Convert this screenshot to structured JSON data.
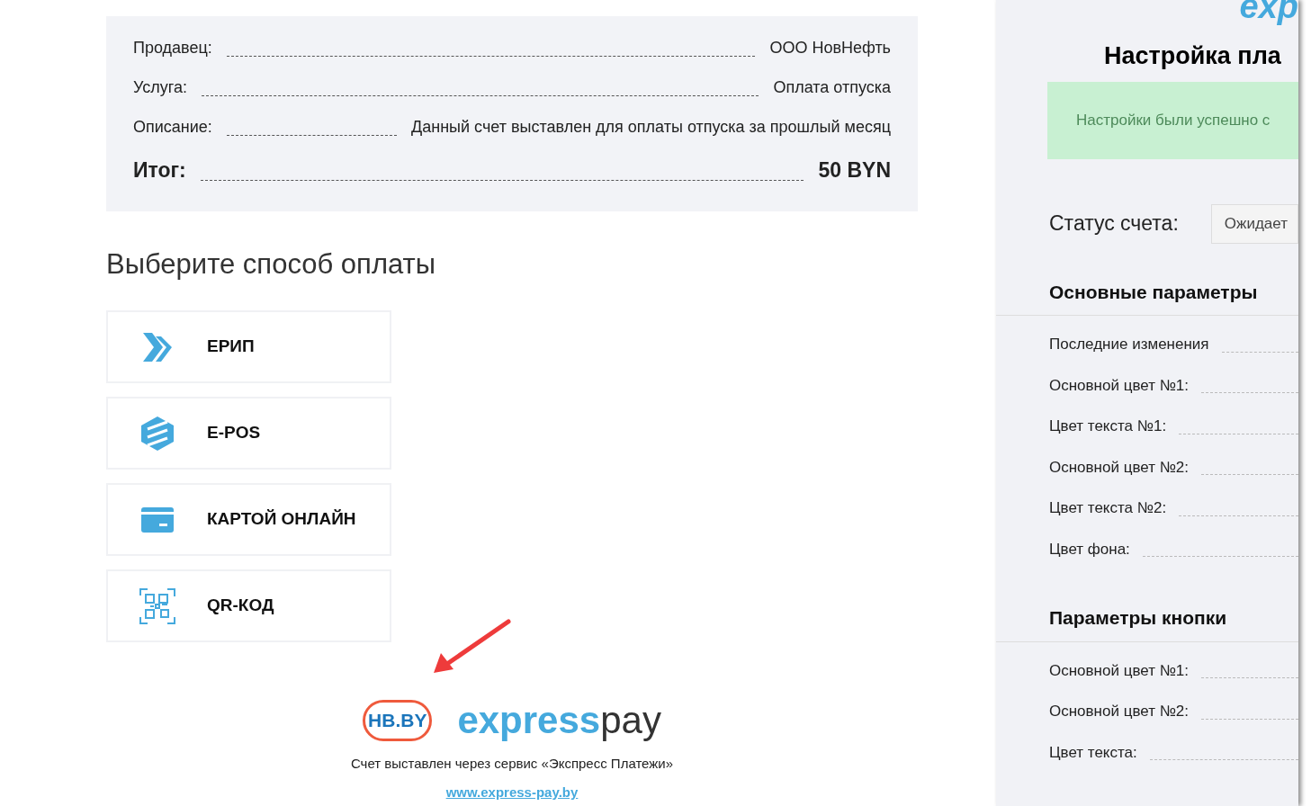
{
  "invoice": {
    "rows": [
      {
        "label": "Продавец:",
        "value": "ООО НовНефть"
      },
      {
        "label": "Услуга:",
        "value": "Оплата отпуска"
      },
      {
        "label": "Описание:",
        "value": "Данный счет выставлен для оплаты отпуска за прошлый месяц"
      }
    ],
    "total": {
      "label": "Итог:",
      "value": "50 BYN"
    }
  },
  "payment": {
    "heading": "Выберите способ оплаты",
    "methods": [
      {
        "kind": "erip",
        "label": "ЕРИП"
      },
      {
        "kind": "epos",
        "label": "E-POS"
      },
      {
        "kind": "card",
        "label": "КАРТОЙ ОНЛАЙН"
      },
      {
        "kind": "qr",
        "label": "QR-КОД"
      }
    ]
  },
  "footer": {
    "partner_logo": "HB.BY",
    "brand_logo": {
      "main": "express",
      "suffix": "pay"
    },
    "note": "Счет выставлен через сервис «Экспресс Платежи»",
    "link": "www.express-pay.by"
  },
  "settings": {
    "logo": "exp",
    "title": "Настройка пла",
    "alert": "Настройки были успешно с",
    "status": {
      "label": "Статус счета:",
      "value": "Ожидает"
    },
    "sections": [
      {
        "title": "Основные параметры",
        "fields": [
          "Последние изменения",
          "Основной цвет №1:",
          "Цвет текста №1:",
          "Основной цвет №2:",
          "Цвет текста №2:",
          "Цвет фона:"
        ]
      },
      {
        "title": "Параметры кнопки",
        "fields": [
          "Основной цвет №1:",
          "Основной цвет №2:",
          "Цвет текста:"
        ]
      }
    ]
  }
}
